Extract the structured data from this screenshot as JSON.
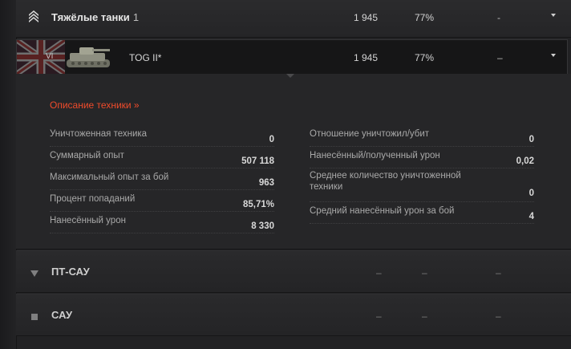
{
  "header": {
    "title": "Тяжёлые танки",
    "count": "1",
    "battles": "1 945",
    "wins": "77%",
    "mark": "-",
    "icon": "heavy-tank-class-icon"
  },
  "vehicle": {
    "tier": "VI",
    "name": "TOG II*",
    "battles": "1 945",
    "wins": "77%",
    "mark": "–",
    "flag": "uk-flag-icon",
    "image": "tank-image"
  },
  "details": {
    "link_label": "Описание техники »",
    "left": [
      {
        "label": "Уничтоженная техника",
        "value": "0"
      },
      {
        "label": "Суммарный опыт",
        "value": "507 118"
      },
      {
        "label": "Максимальный опыт за бой",
        "value": "963"
      },
      {
        "label": "Процент попаданий",
        "value": "85,71%"
      },
      {
        "label": "Нанесённый урон",
        "value": "8 330"
      }
    ],
    "right": [
      {
        "label": "Отношение уничтожил/убит",
        "value": "0"
      },
      {
        "label": "Нанесённый/полученный урон",
        "value": "0,02"
      },
      {
        "label": "Среднее количество уничтоженной техники",
        "value": "0"
      },
      {
        "label": "Средний нанесённый урон за бой",
        "value": "4"
      }
    ]
  },
  "categories": [
    {
      "title": "ПТ-САУ",
      "battles": "–",
      "wins": "–",
      "mark": "–",
      "icon": "tank-destroyer-class-icon"
    },
    {
      "title": "САУ",
      "battles": "–",
      "wins": "–",
      "mark": "–",
      "icon": "spg-class-icon"
    }
  ],
  "colors": {
    "accent_link": "#ef4b2b",
    "background": "#222224"
  }
}
